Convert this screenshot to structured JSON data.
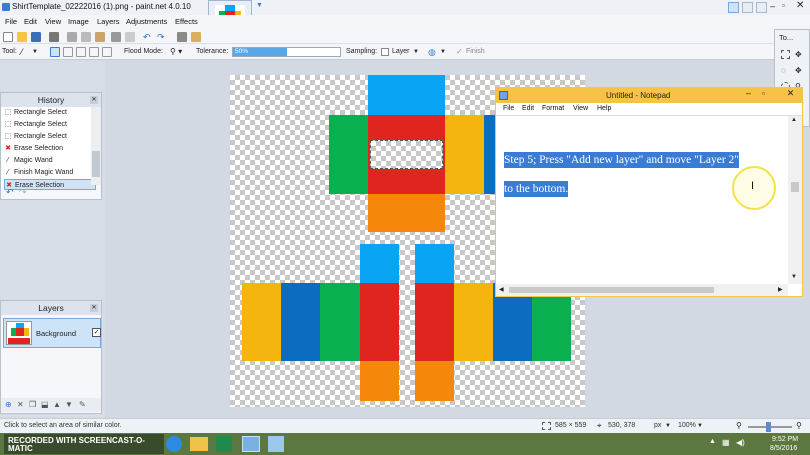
{
  "app": {
    "title": "ShirtTemplate_02222016 (1).png - paint.net 4.0.10"
  },
  "menu": [
    "File",
    "Edit",
    "View",
    "Image",
    "Layers",
    "Adjustments",
    "Effects"
  ],
  "tools_window_label": "To...",
  "toolbar2": {
    "tool_label": "Tool:",
    "flood_mode_label": "Flood Mode:",
    "tolerance_label": "Tolerance:",
    "tolerance_value": "50%",
    "tolerance_fraction": 0.5,
    "sampling_label": "Sampling:",
    "sampling_value": "Layer",
    "finish_label": "Finish"
  },
  "history": {
    "title": "History",
    "items": [
      {
        "label": "Rectangle Select",
        "icon": "rect-select-icon"
      },
      {
        "label": "Rectangle Select",
        "icon": "rect-select-icon"
      },
      {
        "label": "Rectangle Select",
        "icon": "rect-select-icon"
      },
      {
        "label": "Erase Selection",
        "icon": "erase-icon"
      },
      {
        "label": "Magic Wand",
        "icon": "magic-wand-icon"
      },
      {
        "label": "Finish Magic Wand",
        "icon": "magic-wand-icon"
      },
      {
        "label": "Erase Selection",
        "icon": "erase-icon"
      }
    ]
  },
  "layers": {
    "title": "Layers",
    "items": [
      {
        "label": "Background",
        "visible": true
      }
    ]
  },
  "notepad": {
    "title": "Untitled - Notepad",
    "menu": [
      "File",
      "Edit",
      "Format",
      "View",
      "Help"
    ],
    "line1": "Step 5; Press \"Add new layer\" and move \"Layer 2\"",
    "line2": "to the bottom."
  },
  "statusbar": {
    "hint": "Click to select an area of similar color.",
    "size": "585 × 559",
    "position": "530, 378",
    "unit": "px",
    "zoom": "100%"
  },
  "taskbar": {
    "watermark": "RECORDED WITH SCREENCAST-O-MATIC",
    "time": "9:52 PM",
    "date": "8/5/2016"
  },
  "colors": {
    "blue": "#0aa4f4",
    "red": "#e0251f",
    "green": "#0ab050",
    "yellow": "#f5b50f",
    "orange": "#f5880a",
    "darkblue": "#0b6cc0",
    "selection": "#3a7bd5",
    "notepad_title": "#f6c347"
  }
}
